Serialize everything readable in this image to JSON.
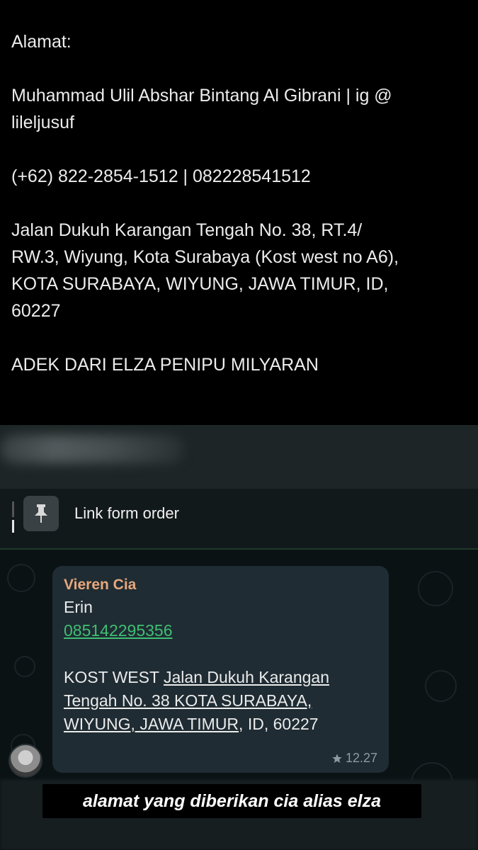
{
  "story": {
    "label": "Alamat:",
    "name_line1": "Muhammad Ulil Abshar Bintang Al Gibrani | ig @",
    "name_line2": "lileljusuf",
    "phone": "(+62) 822-2854-1512 | 082228541512",
    "address_line1": "Jalan Dukuh Karangan Tengah No. 38, RT.4/",
    "address_line2": "RW.3, Wiyung, Kota Surabaya (Kost west no A6),",
    "address_line3": "KOTA SURABAYA, WIYUNG, JAWA TIMUR, ID,",
    "address_line4": "60227",
    "accusation": "ADEK DARI ELZA PENIPU MILYARAN"
  },
  "whatsapp": {
    "pinned_label": "Link form order",
    "message": {
      "sender": "Vieren Cia",
      "line1": "Erin",
      "phone": "085142295356",
      "addr_prefix": "KOST WEST ",
      "addr_line1": "Jalan Dukuh Karangan",
      "addr_line2": "Tengah No. 38 KOTA SURABAYA,",
      "addr_line3_link": "WIYUNG, JAWA TIMUR",
      "addr_line3_rest": ", ID, 60227",
      "time": "12.27"
    }
  },
  "caption": "alamat yang diberikan cia alias elza",
  "icons": {
    "pin": "pin-icon",
    "star": "star-icon",
    "avatar": "avatar"
  },
  "colors": {
    "sender": "#e8a87c",
    "link": "#3fbf73",
    "bubble": "#1f2c33"
  }
}
